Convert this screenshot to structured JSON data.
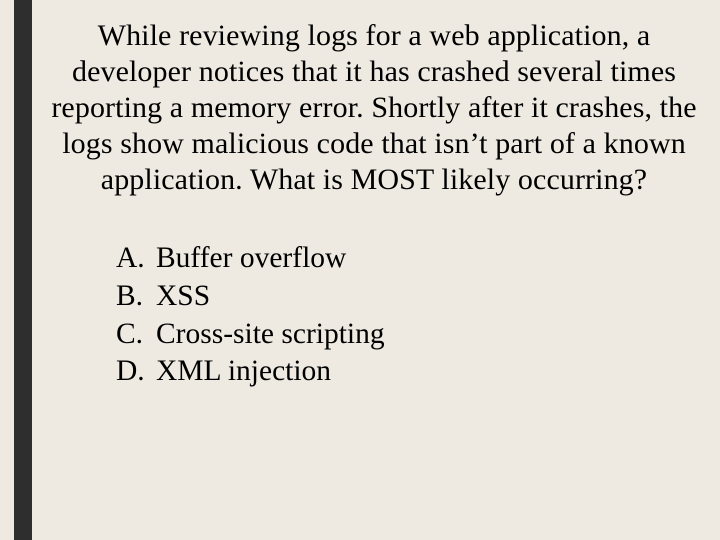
{
  "question": "While reviewing logs for a web application, a developer notices that it has crashed several times reporting a memory error. Shortly after it crashes, the logs show malicious code that isn’t part of a known application. What is MOST likely occurring?",
  "options": [
    {
      "marker": "A.",
      "text": "Buffer overflow"
    },
    {
      "marker": "B.",
      "text": "XSS"
    },
    {
      "marker": "C.",
      "text": "Cross-site scripting"
    },
    {
      "marker": "D.",
      "text": "XML injection"
    }
  ]
}
